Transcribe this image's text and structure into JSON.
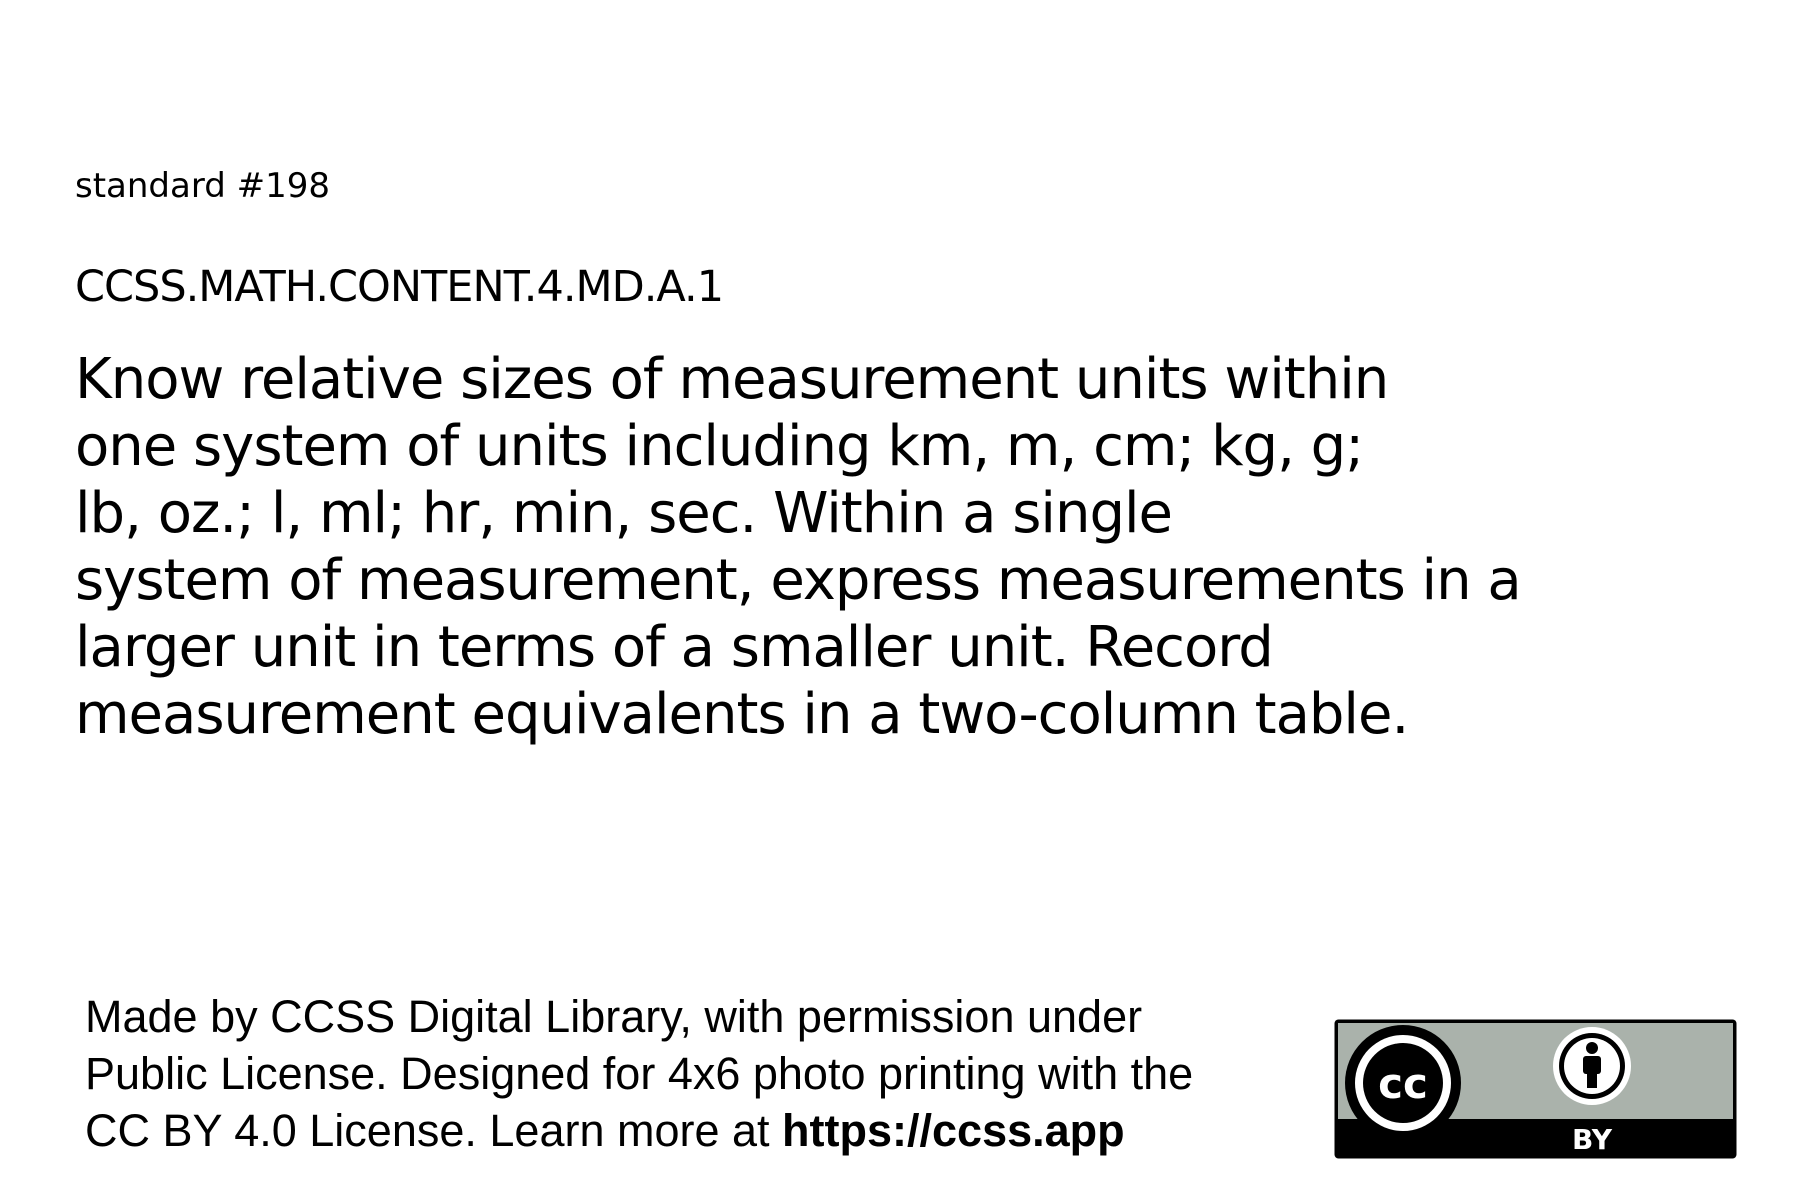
{
  "header": {
    "standard_number": "standard #198",
    "standard_code": "CCSS.MATH.CONTENT.4.MD.A.1"
  },
  "standard_text": {
    "lines": [
      "Know relative sizes of measurement units within",
      "one system of units including km, m, cm; kg, g;",
      "lb, oz.; l, ml; hr, min, sec. Within a single",
      "system of measurement, express measurements in a",
      "larger unit in terms of a smaller unit. Record",
      "measurement equivalents in a two-column table."
    ]
  },
  "footer": {
    "attribution_line_1": "Made by CCSS Digital Library, with permission under",
    "attribution_line_2": "Public License. Designed for 4x6 photo printing with the",
    "attribution_line_3_prefix": "CC BY 4.0 License. Learn more at ",
    "attribution_link": "https://ccss.app",
    "license_badge": {
      "icons": [
        "cc-icon",
        "attribution-person-icon"
      ],
      "by_label": "BY",
      "cc_label": "cc",
      "colors": {
        "badge_gray": "#aab2ab",
        "badge_black": "#000000",
        "badge_white": "#ffffff"
      }
    }
  }
}
